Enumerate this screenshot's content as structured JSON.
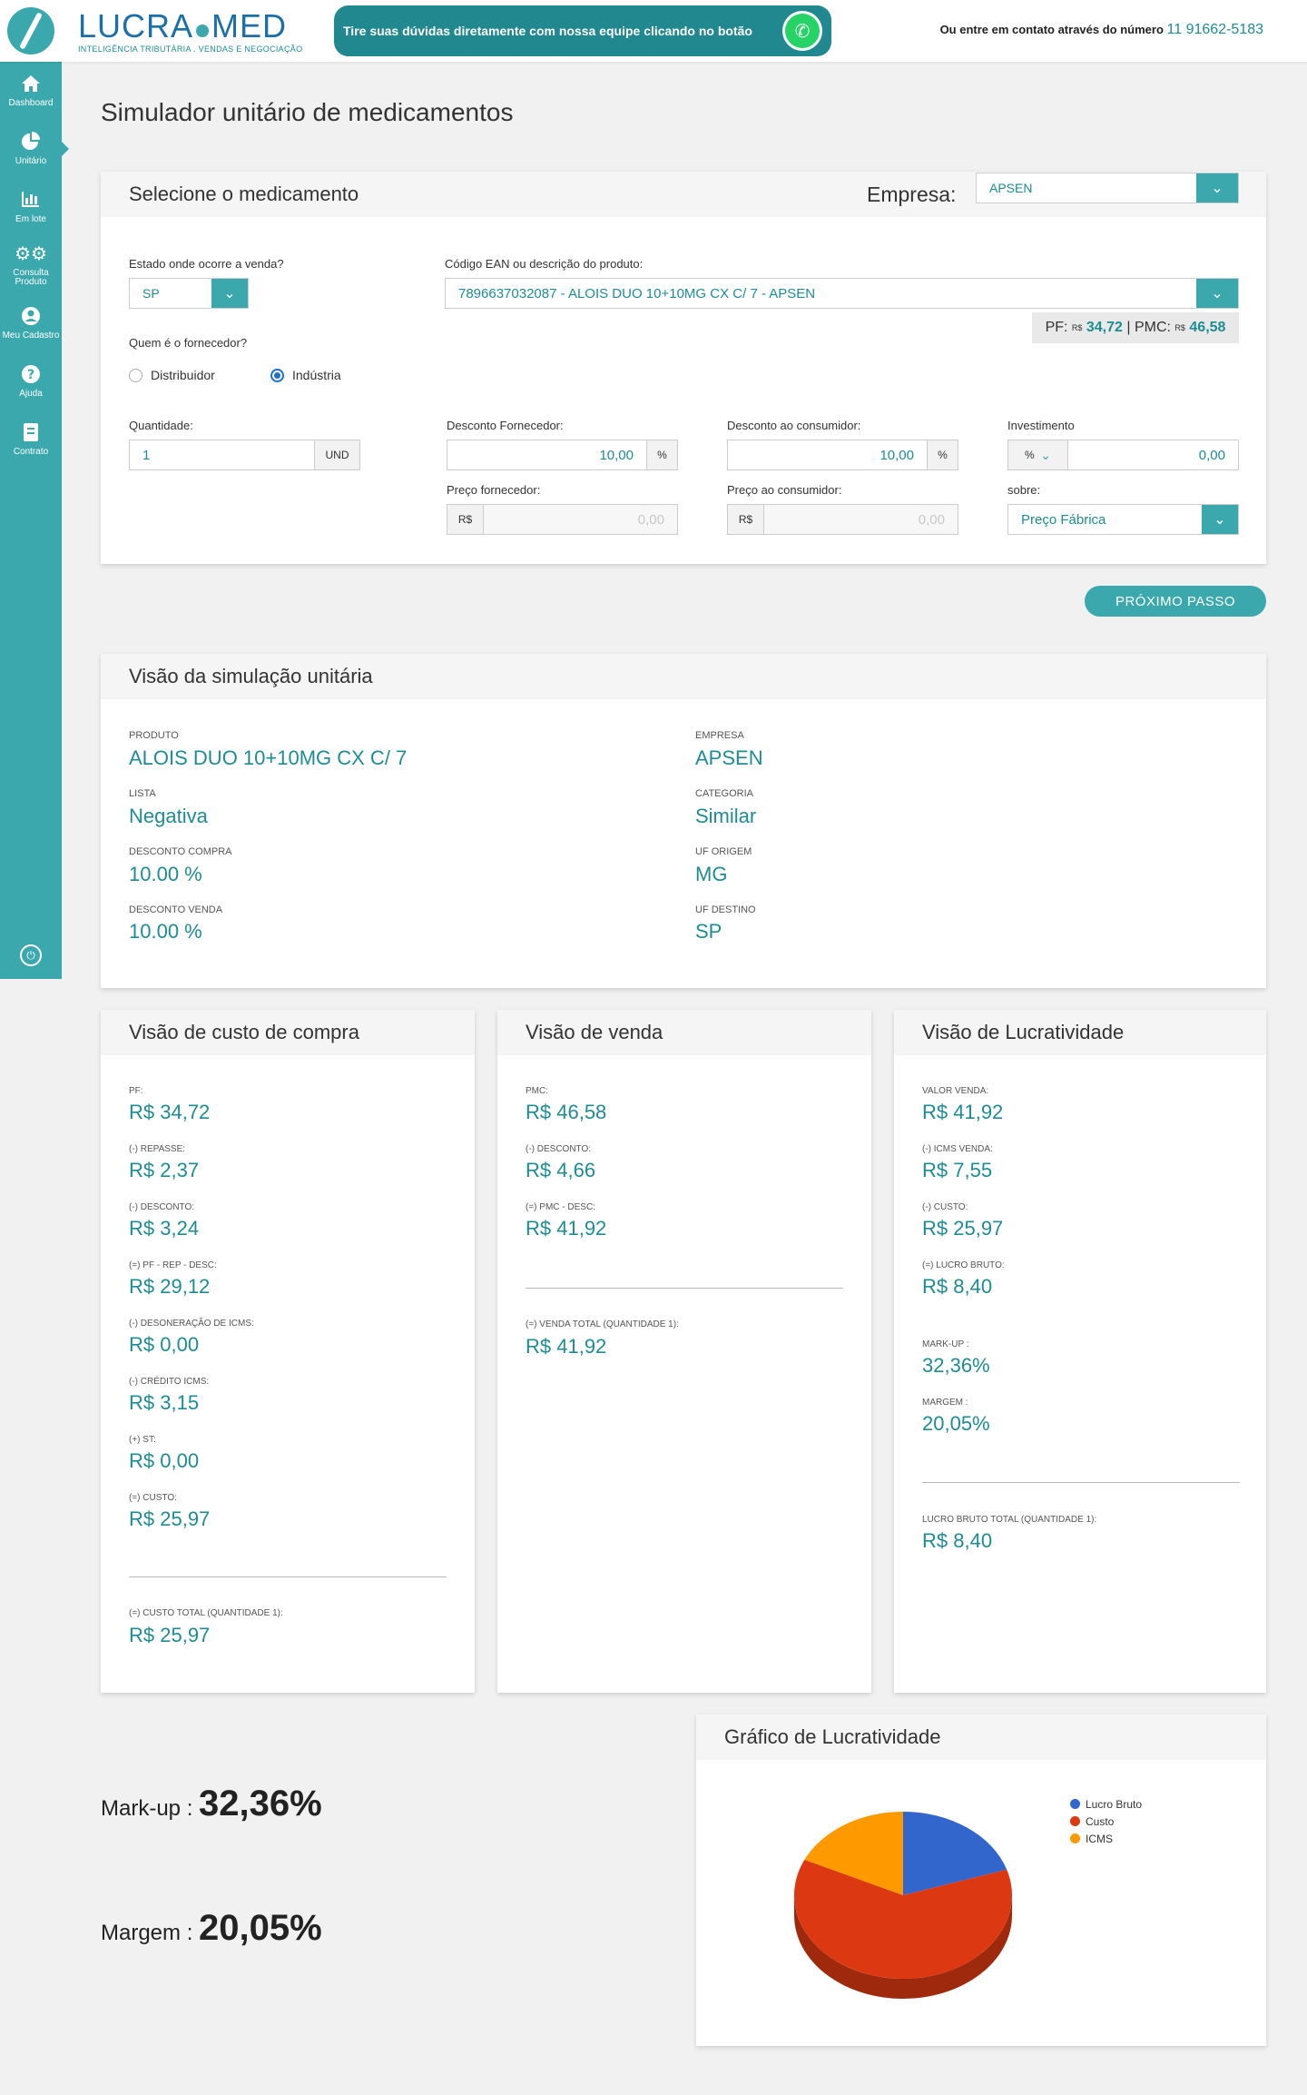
{
  "header": {
    "brand_name": "LUCRA MED",
    "brand_left": "LUCRA",
    "brand_right": "MED",
    "brand_subtitle": "INTELIGÊNCIA TRIBUTÁRIA . VENDAS E NEGOCIAÇÃO",
    "whatsapp_text": "Tire suas dúvidas diretamente com nossa equipe clicando no botão",
    "contact_text": "Ou entre em contato através do número",
    "contact_number": "11 91662-5183"
  },
  "sidebar": {
    "items": [
      {
        "label": "Dashboard",
        "icon": "home-icon"
      },
      {
        "label": "Unitário",
        "icon": "pie-chart-icon"
      },
      {
        "label": "Em lote",
        "icon": "bar-chart-icon"
      },
      {
        "label": "Consulta Produto",
        "icon": "gears-icon"
      },
      {
        "label": "Meu Cadastro",
        "icon": "user-icon"
      },
      {
        "label": "Ajuda",
        "icon": "question-icon"
      },
      {
        "label": "Contrato",
        "icon": "document-icon"
      }
    ],
    "power_icon": "power-icon"
  },
  "page_title": "Simulador unitário de medicamentos",
  "select_card": {
    "title": "Selecione o medicamento",
    "empresa_label": "Empresa:",
    "empresa_value": "APSEN",
    "estado_label": "Estado onde ocorre a venda?",
    "estado_value": "SP",
    "ean_label": "Código EAN ou descrição do produto:",
    "ean_value": "7896637032087 - ALOIS DUO 10+10MG CX C/ 7  - APSEN",
    "pf_label": "PF:",
    "pf_currency": "R$",
    "pf_value": "34,72",
    "pmc_label": "PMC:",
    "pmc_currency": "R$",
    "pmc_value": "46,58",
    "fornecedor_label": "Quem é o fornecedor?",
    "radio_distribuidor": "Distribuidor",
    "radio_industria": "Indústria",
    "quantidade_label": "Quantidade:",
    "quantidade_value": "1",
    "quantidade_unit": "UND",
    "desc_forn_label": "Desconto Fornecedor:",
    "desc_forn_value": "10,00",
    "desc_cons_label": "Desconto ao consumidor:",
    "desc_cons_value": "10,00",
    "percent": "%",
    "investimento_label": "Investimento",
    "investimento_unit": "%",
    "investimento_value": "0,00",
    "preco_forn_label": "Preço fornecedor:",
    "preco_forn_placeholder": "0,00",
    "preco_cons_label": "Preço ao consumidor:",
    "preco_cons_placeholder": "0,00",
    "currency": "R$",
    "sobre_label": "sobre:",
    "sobre_value": "Preço Fábrica"
  },
  "next_button": "PRÓXIMO PASSO",
  "simulation": {
    "title": "Visão da simulação unitária",
    "fields_left": [
      {
        "label": "PRODUTO",
        "value": "ALOIS DUO 10+10MG CX C/ 7"
      },
      {
        "label": "LISTA",
        "value": "Negativa"
      },
      {
        "label": "DESCONTO COMPRA",
        "value": "10.00 %"
      },
      {
        "label": "DESCONTO VENDA",
        "value": "10.00 %"
      }
    ],
    "fields_right": [
      {
        "label": "EMPRESA",
        "value": "APSEN"
      },
      {
        "label": "CATEGORIA",
        "value": "Similar"
      },
      {
        "label": "UF ORIGEM",
        "value": "MG"
      },
      {
        "label": "UF DESTINO",
        "value": "SP"
      }
    ]
  },
  "compra": {
    "title": "Visão de custo de compra",
    "items": [
      {
        "label": "PF:",
        "value": "R$ 34,72"
      },
      {
        "label": "(-) REPASSE:",
        "value": "R$ 2,37"
      },
      {
        "label": "(-) DESCONTO:",
        "value": "R$ 3,24"
      },
      {
        "label": "(=) PF - REP - DESC:",
        "value": "R$ 29,12"
      },
      {
        "label": "(-) DESONERAÇÃO DE ICMS:",
        "value": "R$ 0,00"
      },
      {
        "label": "(-) CRÉDITO ICMS:",
        "value": "R$ 3,15"
      },
      {
        "label": "(+) ST:",
        "value": "R$ 0,00"
      },
      {
        "label": "(=) CUSTO:",
        "value": "R$ 25,97"
      }
    ],
    "total_label": "(=) CUSTO TOTAL (QUANTIDADE 1):",
    "total_value": "R$ 25,97"
  },
  "venda": {
    "title": "Visão de venda",
    "items": [
      {
        "label": "PMC:",
        "value": "R$ 46,58"
      },
      {
        "label": "(-) DESCONTO:",
        "value": "R$ 4,66"
      },
      {
        "label": "(=) PMC - DESC:",
        "value": "R$ 41,92"
      }
    ],
    "total_label": "(=) VENDA TOTAL (QUANTIDADE 1):",
    "total_value": "R$ 41,92"
  },
  "lucratividade": {
    "title": "Visão de Lucratividade",
    "items": [
      {
        "label": "VALOR VENDA:",
        "value": "R$ 41,92"
      },
      {
        "label": "(-) ICMS VENDA:",
        "value": "R$ 7,55"
      },
      {
        "label": "(-) CUSTO:",
        "value": "R$ 25,97"
      },
      {
        "label": "(=) LUCRO BRUTO:",
        "value": "R$ 8,40"
      }
    ],
    "items2": [
      {
        "label": "MARK-UP :",
        "value": "32,36%"
      },
      {
        "label": "MARGEM :",
        "value": "20,05%"
      }
    ],
    "total_label": "LUCRO BRUTO TOTAL (QUANTIDADE 1):",
    "total_value": "R$ 8,40"
  },
  "stats": {
    "markup_label": "Mark-up :",
    "markup_value": "32,36%",
    "margem_label": "Margem :",
    "margem_value": "20,05%"
  },
  "chart_data": {
    "type": "pie",
    "title": "Gráfico de Lucratividade",
    "categories": [
      "Lucro Bruto",
      "Custo",
      "ICMS"
    ],
    "values": [
      8.4,
      25.97,
      7.55
    ],
    "colors": [
      "#3366cc",
      "#dc3912",
      "#ff9900"
    ],
    "legend": "right"
  }
}
